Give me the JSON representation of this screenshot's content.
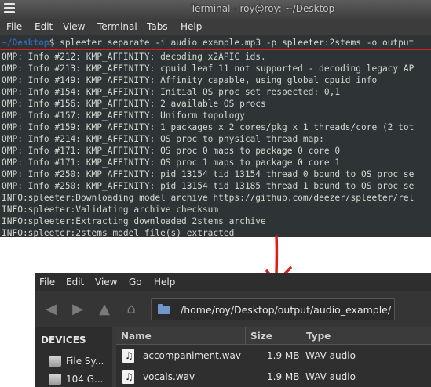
{
  "terminal": {
    "title": "Terminal - roy@roy: ~/Desktop",
    "menu": [
      "File",
      "Edit",
      "View",
      "Terminal",
      "Tabs",
      "Help"
    ],
    "prompt_path": "~/Desktop",
    "prompt_sign": "$",
    "command": " spleeter separate -i audio example.mp3 -p spleeter:2stems -o output",
    "lines": [
      "OMP: Info #212: KMP_AFFINITY: decoding x2APIC ids.",
      "OMP: Info #213: KMP_AFFINITY: cpuid leaf 11 not supported - decoding legacy AP",
      "OMP: Info #149: KMP_AFFINITY: Affinity capable, using global cpuid info",
      "OMP: Info #154: KMP_AFFINITY: Initial OS proc set respected: 0,1",
      "OMP: Info #156: KMP_AFFINITY: 2 available OS procs",
      "OMP: Info #157: KMP_AFFINITY: Uniform topology",
      "OMP: Info #159: KMP_AFFINITY: 1 packages x 2 cores/pkg x 1 threads/core (2 tot",
      "OMP: Info #214: KMP_AFFINITY: OS proc to physical thread map:",
      "OMP: Info #171: KMP_AFFINITY: OS proc 0 maps to package 0 core 0",
      "OMP: Info #171: KMP_AFFINITY: OS proc 1 maps to package 0 core 1",
      "OMP: Info #250: KMP_AFFINITY: pid 13154 tid 13154 thread 0 bound to OS proc se",
      "OMP: Info #250: KMP_AFFINITY: pid 13154 tid 13185 thread 1 bound to OS proc se",
      "INFO:spleeter:Downloading model archive https://github.com/deezer/spleeter/rel",
      "INFO:spleeter:Validating archive checksum",
      "INFO:spleeter:Extracting downloaded 2stems archive",
      "INFO:spleeter:2stems model file(s) extracted"
    ]
  },
  "filemanager": {
    "menu": [
      "File",
      "Edit",
      "View",
      "Go",
      "Help"
    ],
    "path": "/home/roy/Desktop/output/audio_example/",
    "sidebar": {
      "heading": "DEVICES",
      "items": [
        {
          "label": "File Sy...",
          "icon": "drive-icon"
        },
        {
          "label": "104 G...",
          "icon": "drive-icon"
        }
      ]
    },
    "columns": {
      "name": "Name",
      "size": "Size",
      "type": "Type"
    },
    "files": [
      {
        "name": "accompaniment.wav",
        "size": "1.9 MB",
        "type": "WAV audio",
        "icon": "audio-file-icon"
      },
      {
        "name": "vocals.wav",
        "size": "1.9 MB",
        "type": "WAV audio",
        "icon": "audio-file-icon"
      }
    ]
  },
  "colors": {
    "annotation": "#e01b1b",
    "prompt_path": "#3465a4",
    "terminal_bg": "#2e3436"
  }
}
